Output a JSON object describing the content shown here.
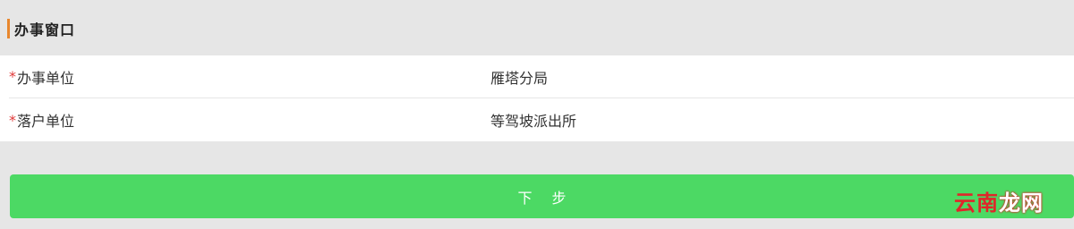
{
  "section": {
    "title": "办事窗口"
  },
  "form": {
    "rows": [
      {
        "required_mark": "*",
        "label": "办事单位",
        "value": "雁塔分局"
      },
      {
        "required_mark": "*",
        "label": "落户单位",
        "value": "等驾坡派出所"
      }
    ]
  },
  "actions": {
    "next_label": "下步"
  },
  "watermark": {
    "part1": "云南",
    "part2": "龙网"
  },
  "colors": {
    "accent": "#e8872e",
    "button": "#4cd964",
    "required": "#e03a3a",
    "background": "#e6e6e6"
  }
}
